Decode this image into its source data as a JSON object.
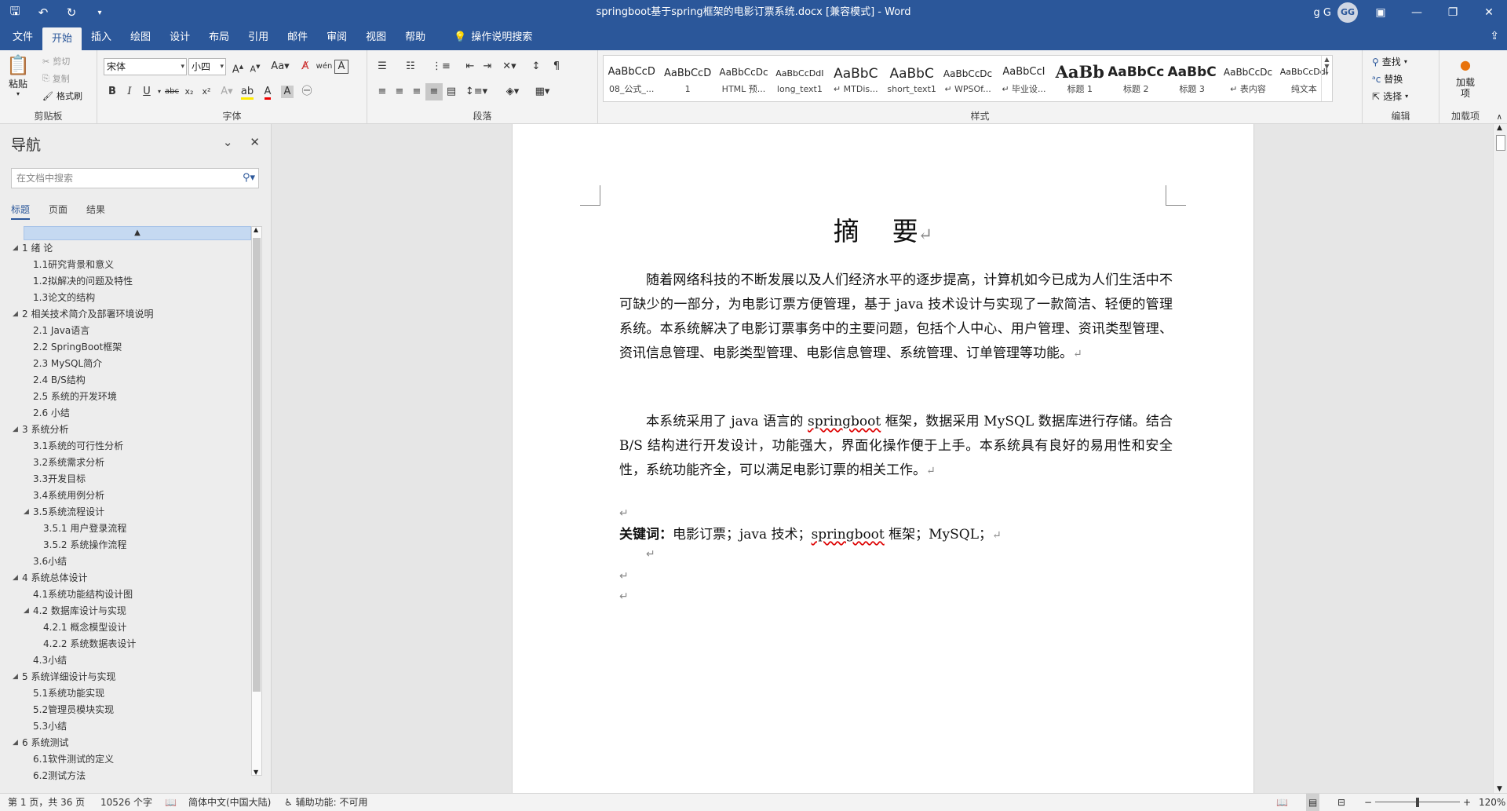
{
  "window": {
    "title": "springboot基于spring框架的电影订票系统.docx [兼容模式] - Word",
    "user_name": "g G",
    "avatar_initials": "GG",
    "qat_icons": [
      "save-icon",
      "undo-icon",
      "redo-icon",
      "customize-icon"
    ]
  },
  "tabs": [
    "文件",
    "开始",
    "插入",
    "绘图",
    "设计",
    "布局",
    "引用",
    "邮件",
    "审阅",
    "视图",
    "帮助"
  ],
  "active_tab": "开始",
  "tell_me": "操作说明搜索",
  "ribbon": {
    "clipboard": {
      "label": "剪贴板",
      "paste": "粘贴",
      "cut": "剪切",
      "copy": "复制",
      "format_painter": "格式刷"
    },
    "font": {
      "label": "字体",
      "family": "宋体",
      "size": "小四"
    },
    "paragraph": {
      "label": "段落"
    },
    "styles": {
      "label": "样式",
      "items": [
        {
          "preview": "AaBbCcD",
          "name": "08_公式_..."
        },
        {
          "preview": "AaBbCcD",
          "name": "1"
        },
        {
          "preview": "AaBbCcDc",
          "name": "HTML 预..."
        },
        {
          "preview": "AaBbCcDdI",
          "name": "long_text1"
        },
        {
          "preview": "AaBbC",
          "name": "↵ MTDis..."
        },
        {
          "preview": "AaBbC",
          "name": "short_text1"
        },
        {
          "preview": "AaBbCcDc",
          "name": "↵ WPSOf..."
        },
        {
          "preview": "AaBbCcI",
          "name": "↵ 毕业设..."
        },
        {
          "preview": "AaBb",
          "name": "标题 1"
        },
        {
          "preview": "AaBbCc",
          "name": "标题 2"
        },
        {
          "preview": "AaBbC",
          "name": "标题 3"
        },
        {
          "preview": "AaBbCcDc",
          "name": "↵ 表内容"
        },
        {
          "preview": "AaBbCcDdI",
          "name": "纯文本"
        }
      ]
    },
    "editing": {
      "label": "编辑",
      "find": "查找",
      "replace": "替换",
      "select": "选择"
    },
    "addins": {
      "label": "加载项",
      "button": "加载项"
    }
  },
  "nav": {
    "title": "导航",
    "search_placeholder": "在文档中搜索",
    "tabs": [
      "标题",
      "页面",
      "结果"
    ],
    "items": [
      {
        "text": "1 绪  论",
        "level": 1,
        "expanded": true
      },
      {
        "text": "1.1研究背景和意义",
        "level": 2
      },
      {
        "text": "1.2拟解决的问题及特性",
        "level": 2
      },
      {
        "text": "1.3论文的结构",
        "level": 2
      },
      {
        "text": "2 相关技术简介及部署环境说明",
        "level": 1,
        "expanded": true
      },
      {
        "text": "2.1 Java语言",
        "level": 2
      },
      {
        "text": "2.2 SpringBoot框架",
        "level": 2
      },
      {
        "text": "2.3 MySQL简介",
        "level": 2
      },
      {
        "text": "2.4 B/S结构",
        "level": 2
      },
      {
        "text": "2.5 系统的开发环境",
        "level": 2
      },
      {
        "text": "2.6 小结",
        "level": 2
      },
      {
        "text": "3 系统分析",
        "level": 1,
        "expanded": true
      },
      {
        "text": "3.1系统的可行性分析",
        "level": 2
      },
      {
        "text": "3.2系统需求分析",
        "level": 2
      },
      {
        "text": "3.3开发目标",
        "level": 2
      },
      {
        "text": "3.4系统用例分析",
        "level": 2
      },
      {
        "text": "3.5系统流程设计",
        "level": 2,
        "expanded": true
      },
      {
        "text": "3.5.1 用户登录流程",
        "level": 3
      },
      {
        "text": "3.5.2 系统操作流程",
        "level": 3
      },
      {
        "text": "3.6小结",
        "level": 2
      },
      {
        "text": "4 系统总体设计",
        "level": 1,
        "expanded": true
      },
      {
        "text": "4.1系统功能结构设计图",
        "level": 2
      },
      {
        "text": "4.2 数据库设计与实现",
        "level": 2,
        "expanded": true
      },
      {
        "text": "4.2.1 概念模型设计",
        "level": 3
      },
      {
        "text": "4.2.2 系统数据表设计",
        "level": 3
      },
      {
        "text": "4.3小结",
        "level": 2
      },
      {
        "text": "5 系统详细设计与实现",
        "level": 1,
        "expanded": true
      },
      {
        "text": "5.1系统功能实现",
        "level": 2
      },
      {
        "text": "5.2管理员模块实现",
        "level": 2
      },
      {
        "text": "5.3小结",
        "level": 2
      },
      {
        "text": "6 系统测试",
        "level": 1,
        "expanded": true
      },
      {
        "text": "6.1软件测试的定义",
        "level": 2
      },
      {
        "text": "6.2测试方法",
        "level": 2
      }
    ]
  },
  "document": {
    "heading": "摘    要",
    "para1": "随着网络科技的不断发展以及人们经济水平的逐步提高，计算机如今已成为人们生活中不可缺少的一部分，为电影订票方便管理，基于 java 技术设计与实现了一款简洁、轻便的管理系统。本系统解决了电影订票事务中的主要问题，包括个人中心、用户管理、资讯类型管理、资讯信息管理、电影类型管理、电影信息管理、系统管理、订单管理等功能。",
    "para2_a": "本系统采用了 java 语言的 ",
    "para2_b": "springboot",
    "para2_c": " 框架，数据采用 MySQL 数据库进行存储。结合 B/S 结构进行开发设计，功能强大，界面化操作便于上手。本系统具有良好的易用性和安全性，系统功能齐全，可以满足电影订票的相关工作。",
    "kw_label": "关键词：",
    "kw_a": "电影订票；java 技术；",
    "kw_b": "springboot",
    "kw_c": " 框架；MySQL；",
    "para_mark": "↵"
  },
  "status": {
    "page": "第 1 页，共 36 页",
    "words": "10526 个字",
    "language": "简体中文(中国大陆)",
    "accessibility": "辅助功能: 不可用",
    "zoom": "120%",
    "zoom_fraction": 0.5
  },
  "colors": {
    "brand": "#2b579a",
    "ribbon": "#f3f3f3",
    "spell": "#dd0000"
  }
}
